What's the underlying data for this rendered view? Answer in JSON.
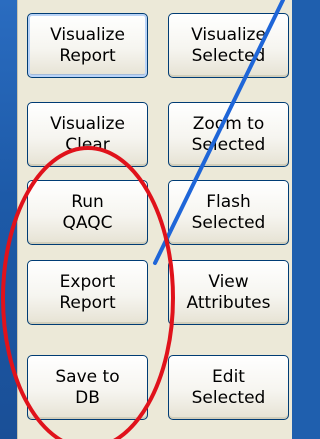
{
  "buttons": {
    "visualize_report": "Visualize\nReport",
    "visualize_selected": "Visualize\nSelected",
    "visualize_clear": "Visualize\nClear",
    "zoom_to_selected": "Zoom to\nSelected",
    "run_qaqc": "Run\nQAQC",
    "flash_selected": "Flash\nSelected",
    "export_report": "Export\nReport",
    "view_attributes": "View\nAttributes",
    "save_to_db": "Save to\nDB",
    "edit_selected": "Edit\nSelected"
  },
  "annotations": {
    "arrow_color": "#1f66d8",
    "ellipse_color": "#e0121b"
  }
}
